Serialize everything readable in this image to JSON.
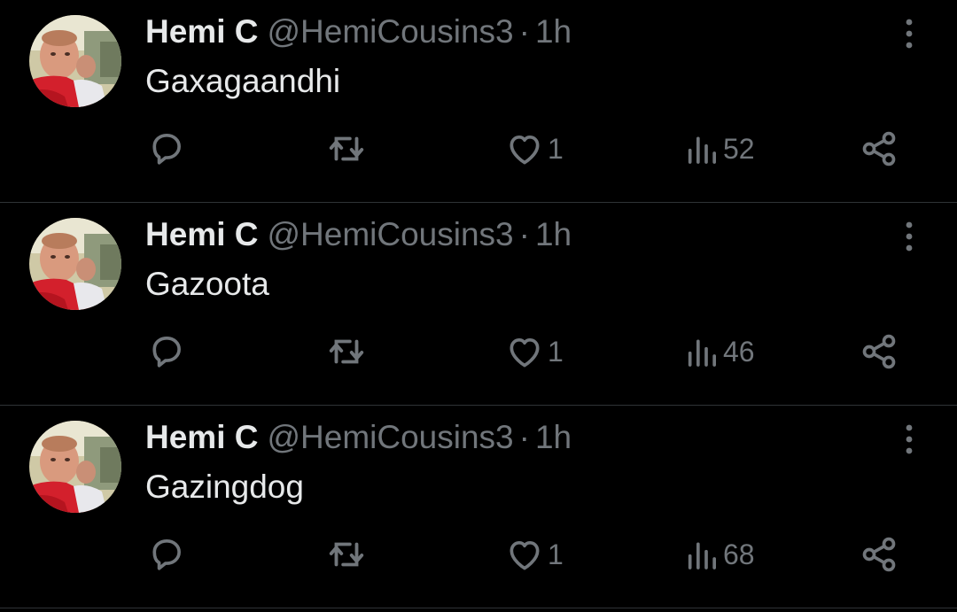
{
  "colors": {
    "background": "#000000",
    "primary_text": "#e7e9ea",
    "secondary_text": "#71767b",
    "divider": "#2f3336"
  },
  "icons": {
    "reply": "reply-icon",
    "retweet": "retweet-icon",
    "like": "heart-icon",
    "views": "views-icon",
    "share": "share-icon",
    "more": "more-icon"
  },
  "tweets": [
    {
      "display_name": "Hemi C",
      "handle": "@HemiCousins3",
      "separator": "·",
      "time": "1h",
      "text": "Gaxagaandhi",
      "likes": "1",
      "views": "52"
    },
    {
      "display_name": "Hemi C",
      "handle": "@HemiCousins3",
      "separator": "·",
      "time": "1h",
      "text": "Gazoota",
      "likes": "1",
      "views": "46"
    },
    {
      "display_name": "Hemi C",
      "handle": "@HemiCousins3",
      "separator": "·",
      "time": "1h",
      "text": "Gazingdog",
      "likes": "1",
      "views": "68"
    }
  ]
}
